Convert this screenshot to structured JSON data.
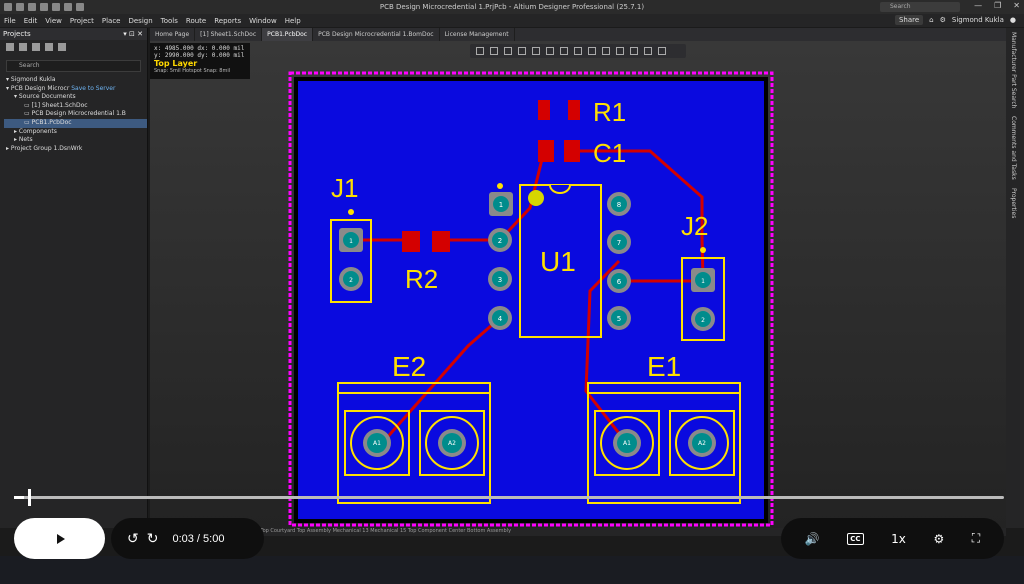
{
  "window": {
    "title": "PCB Design Microcredential 1.PrjPcb - Altium Designer Professional (25.7.1)",
    "search_placeholder": "Search",
    "controls": [
      "—",
      "❐",
      "✕"
    ]
  },
  "menu": {
    "items": [
      "File",
      "Edit",
      "View",
      "Project",
      "Place",
      "Design",
      "Tools",
      "Route",
      "Reports",
      "Window",
      "Help"
    ],
    "share_label": "Share",
    "user": "Sigmond Kukla"
  },
  "projects": {
    "title": "Projects",
    "search_placeholder": "Search",
    "tree": [
      {
        "label": "Sigmond Kukla",
        "indent": 0,
        "icon": "user-icon"
      },
      {
        "label": "PCB Design Microcr",
        "status": "Save to Server",
        "indent": 0,
        "icon": "project-icon"
      },
      {
        "label": "Source Documents",
        "indent": 1,
        "icon": "folder-icon"
      },
      {
        "label": "[1] Sheet1.SchDoc",
        "indent": 2,
        "icon": "schematic-icon"
      },
      {
        "label": "PCB Design Microcredential 1.B",
        "indent": 2,
        "icon": "bom-icon"
      },
      {
        "label": "PCB1.PcbDoc",
        "indent": 2,
        "icon": "pcb-icon",
        "selected": true
      },
      {
        "label": "Components",
        "indent": 1,
        "icon": "folder-icon"
      },
      {
        "label": "Nets",
        "indent": 1,
        "icon": "folder-icon"
      },
      {
        "label": "Project Group 1.DsnWrk",
        "indent": 0,
        "icon": "group-icon"
      }
    ]
  },
  "tabs": [
    {
      "label": "Home Page",
      "active": false
    },
    {
      "label": "[1] Sheet1.SchDoc",
      "active": false
    },
    {
      "label": "PCB1.PcbDoc",
      "active": true
    },
    {
      "label": "PCB Design Microcredential 1.BomDoc",
      "active": false
    },
    {
      "label": "License Management",
      "active": false
    }
  ],
  "right_panels": [
    "Manufacturer Part Search",
    "Comments and Tasks",
    "Properties"
  ],
  "coords": {
    "x_line": "x:  4985.000   dx:    0.000 mil",
    "y_line": "y:  2990.000   dy:    0.000 mil",
    "layer": "Top Layer",
    "snap": "Snap: 5mil Hotspot Snap: 8mil"
  },
  "pcb": {
    "colors": {
      "board": "#0a0adf",
      "outline": "#ff00ff",
      "track": "#d40000",
      "silk": "#ffe000",
      "pad": "#8a8a8a",
      "via": "#008c8c"
    },
    "labels": {
      "r1": "R1",
      "c1": "C1",
      "j1": "J1",
      "j2": "J2",
      "r2": "R2",
      "u1": "U1",
      "e2": "E2",
      "e1": "E1"
    },
    "u1_pins": [
      "1",
      "2",
      "3",
      "4",
      "5",
      "6",
      "7",
      "8"
    ],
    "j_pins": [
      "1",
      "2"
    ],
    "cap_pins": [
      "A1",
      "A2"
    ]
  },
  "layers_bar": "LS  Bottom Layer   Mechanical 1   Top 3D Body   Top Courtyard   Top Assembly   Mechanical 13   Mechanical 15   Top Component Center   Bottom Assembly",
  "video": {
    "time": "0:03 / 5:00",
    "progress": 0.01,
    "speed": "1x",
    "cc": "CC"
  }
}
